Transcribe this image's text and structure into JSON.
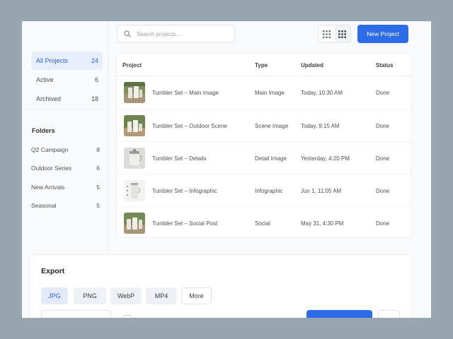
{
  "sidebar": {
    "items": [
      {
        "label": "All Projects",
        "count": "24",
        "active": true
      },
      {
        "label": "Active",
        "count": "6",
        "active": false
      },
      {
        "label": "Archived",
        "count": "18",
        "active": false
      }
    ],
    "folders_heading": "Folders",
    "folders": [
      {
        "label": "Q2 Campaign",
        "count": "8"
      },
      {
        "label": "Outdoor Series",
        "count": "6"
      },
      {
        "label": "New Arrivals",
        "count": "5"
      },
      {
        "label": "Seasonal",
        "count": "5"
      }
    ]
  },
  "toolbar": {
    "search_placeholder": "Search projects...",
    "new_project_label": "New Project",
    "view_icons": [
      "grid-small-icon",
      "grid-large-icon"
    ]
  },
  "table": {
    "headers": {
      "project": "Project",
      "type": "Type",
      "updated": "Updated",
      "status": "Status"
    },
    "rows": [
      {
        "name": "Tumbler Set – Main Image",
        "type": "Main Image",
        "updated": "Today, 10:30 AM",
        "status": "Done",
        "thumb": "photo-outdoor"
      },
      {
        "name": "Tumbler Set – Outdoor Scene",
        "type": "Scene Image",
        "updated": "Today, 9:15 AM",
        "status": "Done",
        "thumb": "photo-outdoor"
      },
      {
        "name": "Tumbler Set – Details",
        "type": "Detail Image",
        "updated": "Yesterday, 4:20 PM",
        "status": "Done",
        "thumb": "photo-detail"
      },
      {
        "name": "Tumbler Set – Infographic",
        "type": "Infographic",
        "updated": "Jun 1, 11:05 AM",
        "status": "Done",
        "thumb": "photo-infographic"
      },
      {
        "name": "Tumbler Set – Social Post",
        "type": "Social",
        "updated": "May 31, 4:30 PM",
        "status": "Done",
        "thumb": "photo-outdoor"
      }
    ]
  },
  "export": {
    "title": "Export",
    "formats": [
      {
        "label": "JPG",
        "selected": true
      },
      {
        "label": "PNG",
        "selected": false
      },
      {
        "label": "WebP",
        "selected": false
      },
      {
        "label": "MP4",
        "selected": false
      }
    ],
    "more_label": "More"
  },
  "colors": {
    "accent": "#2e6be6",
    "active_bg": "#e8eefc",
    "page_bg": "#97a6af"
  }
}
